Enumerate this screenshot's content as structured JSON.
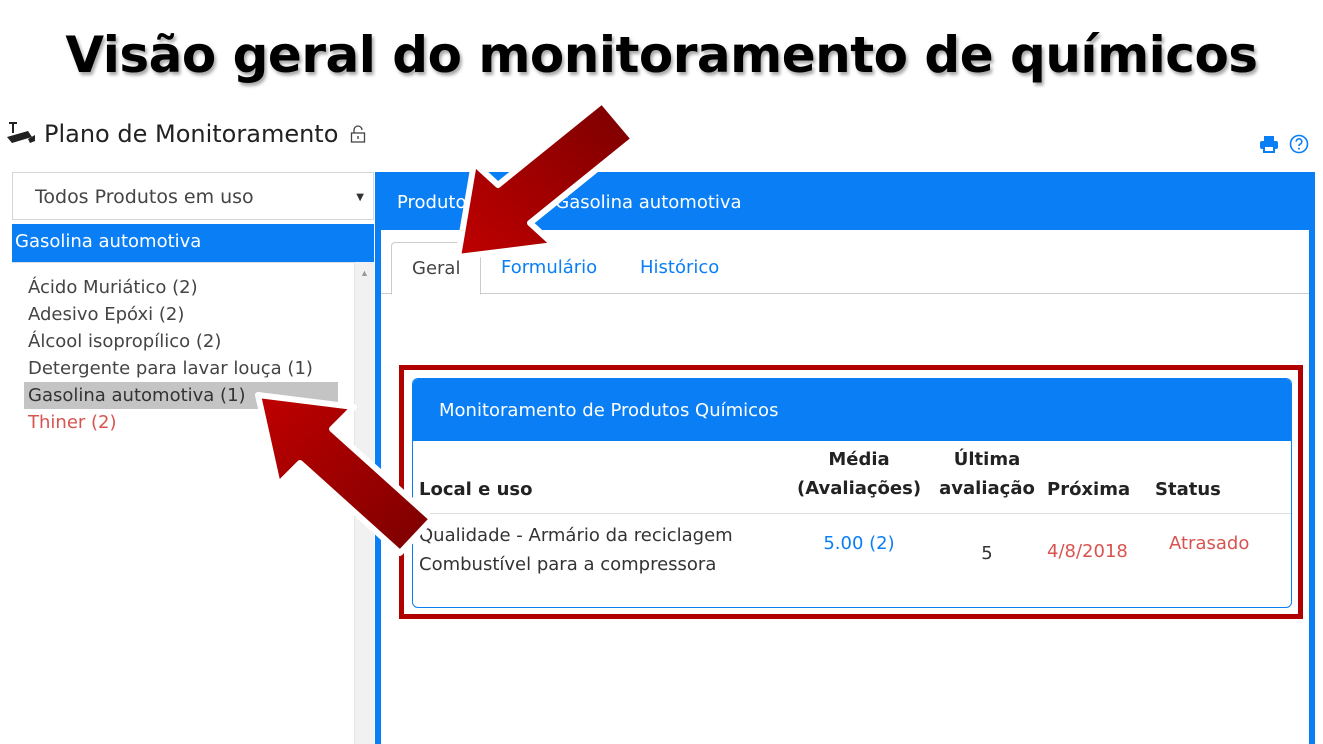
{
  "slide_title": "Visão geral do monitoramento de químicos",
  "app": {
    "title": "Plano de Monitoramento"
  },
  "icons": {
    "camera": "security-camera-icon",
    "lock": "lock-icon",
    "print": "print-icon",
    "help": "help-icon"
  },
  "colors": {
    "primary": "#0a7ff5",
    "danger": "#d9534f",
    "highlight": "#b00000",
    "arrow": "#b50000"
  },
  "filter": {
    "value": "Todos Produtos em uso"
  },
  "selected_product": "Gasolina automotiva",
  "product_list": [
    {
      "label": "Ácido Muriático (2)",
      "state": "normal"
    },
    {
      "label": "Adesivo Epóxi (2)",
      "state": "normal"
    },
    {
      "label": "Álcool isopropílico (2)",
      "state": "normal"
    },
    {
      "label": "Detergente para lavar louça (1)",
      "state": "normal"
    },
    {
      "label": "Gasolina automotiva (1)",
      "state": "active"
    },
    {
      "label": "Thiner (2)",
      "state": "overdue"
    }
  ],
  "detail": {
    "header": "Produto químico: Gasolina automotiva",
    "tabs": [
      "Geral",
      "Formulário",
      "Histórico"
    ],
    "active_tab": "Geral"
  },
  "card": {
    "title": "Monitoramento de Produtos Químicos",
    "columns": {
      "local": "Local e uso",
      "media_1": "Média",
      "media_2": "(Avaliações)",
      "ultima_1": "Última",
      "ultima_2": "avaliação",
      "proxima": "Próxima",
      "status": "Status"
    },
    "rows": [
      {
        "local_1": "Qualidade - Armário da reciclagem",
        "local_2": "Combustível para a compressora",
        "media": "5.00 (2)",
        "ultima": "5",
        "proxima": "4/8/2018",
        "status": "Atrasado"
      }
    ]
  }
}
